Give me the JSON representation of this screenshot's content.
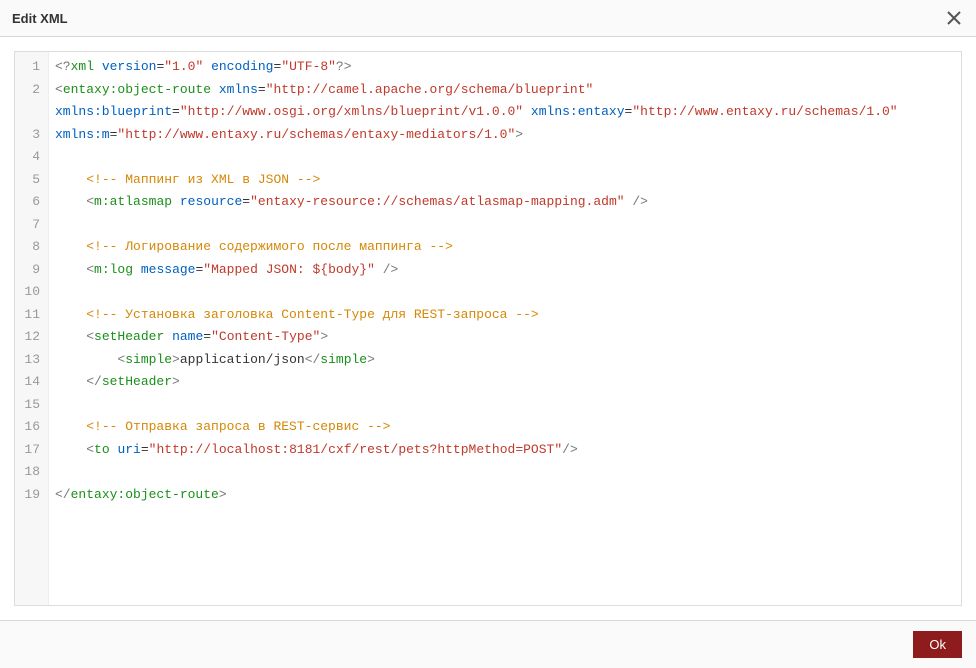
{
  "header": {
    "title": "Edit XML"
  },
  "footer": {
    "ok_label": "Ok"
  },
  "editor": {
    "line_count": 19,
    "gutter": [
      "1",
      "2",
      "",
      "3",
      "4",
      "5",
      "6",
      "7",
      "8",
      "9",
      "10",
      "11",
      "12",
      "13",
      "14",
      "15",
      "16",
      "17",
      "18",
      "19"
    ],
    "code_lines": [
      [
        {
          "cls": "meta",
          "t": "<?"
        },
        {
          "cls": "tag",
          "t": "xml"
        },
        {
          "cls": "text",
          "t": " "
        },
        {
          "cls": "attr",
          "t": "version"
        },
        {
          "cls": "text",
          "t": "="
        },
        {
          "cls": "string",
          "t": "\"1.0\""
        },
        {
          "cls": "text",
          "t": " "
        },
        {
          "cls": "attr",
          "t": "encoding"
        },
        {
          "cls": "text",
          "t": "="
        },
        {
          "cls": "string",
          "t": "\"UTF-8\""
        },
        {
          "cls": "meta",
          "t": "?>"
        }
      ],
      [
        {
          "cls": "meta",
          "t": "<"
        },
        {
          "cls": "tag",
          "t": "entaxy:object-route"
        },
        {
          "cls": "text",
          "t": " "
        },
        {
          "cls": "attr",
          "t": "xmlns"
        },
        {
          "cls": "text",
          "t": "="
        },
        {
          "cls": "string",
          "t": "\"http://camel.apache.org/schema/blueprint\""
        },
        {
          "cls": "text",
          "t": " "
        }
      ],
      [
        {
          "cls": "attr",
          "t": "xmlns:blueprint"
        },
        {
          "cls": "text",
          "t": "="
        },
        {
          "cls": "string",
          "t": "\"http://www.osgi.org/xmlns/blueprint/v1.0.0\""
        },
        {
          "cls": "text",
          "t": " "
        },
        {
          "cls": "attr",
          "t": "xmlns:entaxy"
        },
        {
          "cls": "text",
          "t": "="
        },
        {
          "cls": "string",
          "t": "\"http://www.entaxy.ru/schemas/1.0\""
        },
        {
          "cls": "text",
          "t": " "
        }
      ],
      [
        {
          "cls": "attr",
          "t": "xmlns:m"
        },
        {
          "cls": "text",
          "t": "="
        },
        {
          "cls": "string",
          "t": "\"http://www.entaxy.ru/schemas/entaxy-mediators/1.0\""
        },
        {
          "cls": "meta",
          "t": ">"
        }
      ],
      [],
      [
        {
          "cls": "text",
          "t": "    "
        },
        {
          "cls": "comment",
          "t": "<!-- Маппинг из XML в JSON -->"
        }
      ],
      [
        {
          "cls": "text",
          "t": "    "
        },
        {
          "cls": "meta",
          "t": "<"
        },
        {
          "cls": "tag",
          "t": "m:atlasmap"
        },
        {
          "cls": "text",
          "t": " "
        },
        {
          "cls": "attr",
          "t": "resource"
        },
        {
          "cls": "text",
          "t": "="
        },
        {
          "cls": "string",
          "t": "\"entaxy-resource://schemas/atlasmap-mapping.adm\""
        },
        {
          "cls": "text",
          "t": " "
        },
        {
          "cls": "meta",
          "t": "/>"
        }
      ],
      [],
      [
        {
          "cls": "text",
          "t": "    "
        },
        {
          "cls": "comment",
          "t": "<!-- Логирование содержимого после маппинга -->"
        }
      ],
      [
        {
          "cls": "text",
          "t": "    "
        },
        {
          "cls": "meta",
          "t": "<"
        },
        {
          "cls": "tag",
          "t": "m:log"
        },
        {
          "cls": "text",
          "t": " "
        },
        {
          "cls": "attr",
          "t": "message"
        },
        {
          "cls": "text",
          "t": "="
        },
        {
          "cls": "string",
          "t": "\"Mapped JSON: ${body}\""
        },
        {
          "cls": "text",
          "t": " "
        },
        {
          "cls": "meta",
          "t": "/>"
        }
      ],
      [],
      [
        {
          "cls": "text",
          "t": "    "
        },
        {
          "cls": "comment",
          "t": "<!-- Установка заголовка Content-Type для REST-запроса -->"
        }
      ],
      [
        {
          "cls": "text",
          "t": "    "
        },
        {
          "cls": "meta",
          "t": "<"
        },
        {
          "cls": "tag",
          "t": "setHeader"
        },
        {
          "cls": "text",
          "t": " "
        },
        {
          "cls": "attr",
          "t": "name"
        },
        {
          "cls": "text",
          "t": "="
        },
        {
          "cls": "string",
          "t": "\"Content-Type\""
        },
        {
          "cls": "meta",
          "t": ">"
        }
      ],
      [
        {
          "cls": "text",
          "t": "        "
        },
        {
          "cls": "meta",
          "t": "<"
        },
        {
          "cls": "tag",
          "t": "simple"
        },
        {
          "cls": "meta",
          "t": ">"
        },
        {
          "cls": "text",
          "t": "application/json"
        },
        {
          "cls": "meta",
          "t": "</"
        },
        {
          "cls": "tag",
          "t": "simple"
        },
        {
          "cls": "meta",
          "t": ">"
        }
      ],
      [
        {
          "cls": "text",
          "t": "    "
        },
        {
          "cls": "meta",
          "t": "</"
        },
        {
          "cls": "tag",
          "t": "setHeader"
        },
        {
          "cls": "meta",
          "t": ">"
        }
      ],
      [],
      [
        {
          "cls": "text",
          "t": "    "
        },
        {
          "cls": "comment",
          "t": "<!-- Отправка запроса в REST-сервис -->"
        }
      ],
      [
        {
          "cls": "text",
          "t": "    "
        },
        {
          "cls": "meta",
          "t": "<"
        },
        {
          "cls": "tag",
          "t": "to"
        },
        {
          "cls": "text",
          "t": " "
        },
        {
          "cls": "attr",
          "t": "uri"
        },
        {
          "cls": "text",
          "t": "="
        },
        {
          "cls": "string",
          "t": "\"http://localhost:8181/cxf/rest/pets?httpMethod=POST\""
        },
        {
          "cls": "meta",
          "t": "/>"
        }
      ],
      [],
      [
        {
          "cls": "meta",
          "t": "</"
        },
        {
          "cls": "tag",
          "t": "entaxy:object-route"
        },
        {
          "cls": "meta",
          "t": ">"
        }
      ],
      []
    ]
  }
}
